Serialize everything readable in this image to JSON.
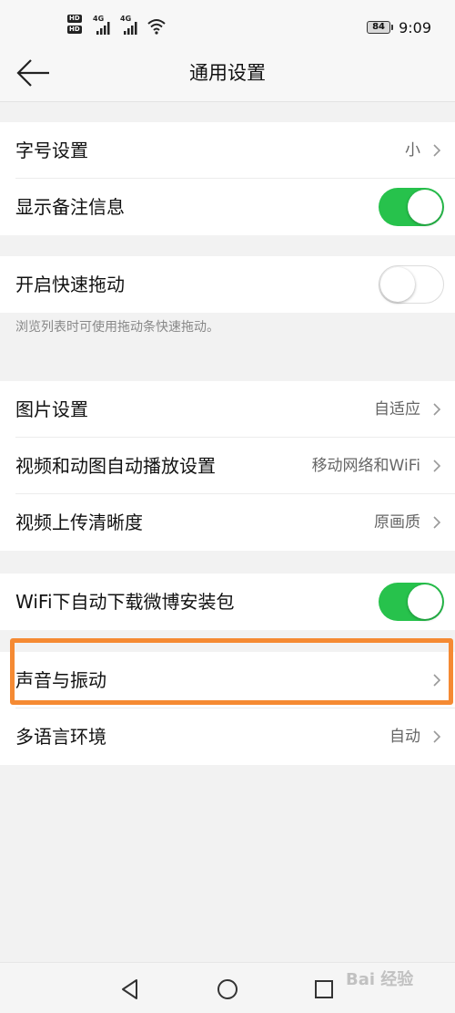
{
  "status_bar": {
    "hd1": "HD",
    "hd2": "HD",
    "net1": "4G",
    "net2": "4G",
    "battery": "84",
    "time": "9:09"
  },
  "nav": {
    "title": "通用设置"
  },
  "rows": {
    "font_size": {
      "label": "字号设置",
      "value": "小"
    },
    "show_remarks": {
      "label": "显示备注信息",
      "toggle": "on"
    },
    "quick_drag": {
      "label": "开启快速拖动",
      "toggle": "off",
      "hint": "浏览列表时可使用拖动条快速拖动。"
    },
    "image_settings": {
      "label": "图片设置",
      "value": "自适应"
    },
    "video_autoplay": {
      "label": "视频和动图自动播放设置",
      "value": "移动网络和WiFi"
    },
    "video_upload": {
      "label": "视频上传清晰度",
      "value": "原画质"
    },
    "wifi_download": {
      "label": "WiFi下自动下载微博安装包",
      "toggle": "on"
    },
    "sound_vibration": {
      "label": "声音与振动"
    },
    "language": {
      "label": "多语言环境",
      "value": "自动"
    }
  },
  "colors": {
    "toggle_on": "#27c24c",
    "highlight": "#f58a33",
    "page_bg": "#f2f2f2"
  },
  "watermark": "Bai 经验"
}
